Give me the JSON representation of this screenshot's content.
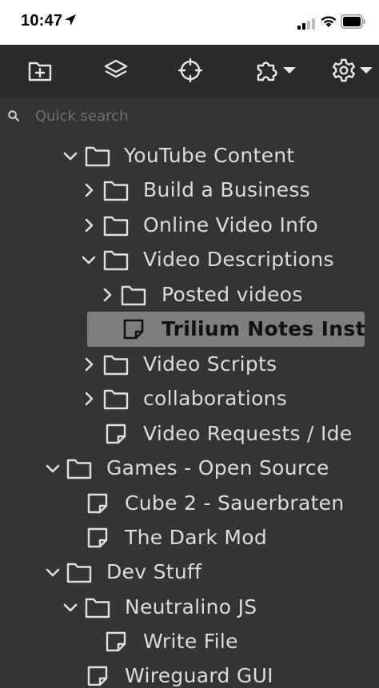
{
  "status_bar": {
    "time": "10:47"
  },
  "toolbar": {
    "buttons": [
      {
        "name": "new-note-icon"
      },
      {
        "name": "collapse-tree-icon"
      },
      {
        "name": "scroll-to-active-icon"
      },
      {
        "name": "plugins-icon"
      },
      {
        "name": "settings-icon"
      }
    ]
  },
  "search": {
    "placeholder": "Quick search",
    "value": ""
  },
  "tree": {
    "items": [
      {
        "label": "YouTube Content",
        "type": "folder",
        "expanded": true
      },
      {
        "label": "Build a Business",
        "type": "folder",
        "expanded": false
      },
      {
        "label": "Online Video Info",
        "type": "folder",
        "expanded": false
      },
      {
        "label": "Video Descriptions",
        "type": "folder",
        "expanded": true
      },
      {
        "label": "Posted videos",
        "type": "folder",
        "expanded": false
      },
      {
        "label": "Trilium Notes Insta",
        "type": "note",
        "active": true
      },
      {
        "label": "Video Scripts",
        "type": "folder",
        "expanded": false
      },
      {
        "label": "collaborations",
        "type": "folder",
        "expanded": false
      },
      {
        "label": "Video Requests / Ide",
        "type": "note"
      },
      {
        "label": "Games - Open Source",
        "type": "folder",
        "expanded": true
      },
      {
        "label": "Cube 2 - Sauerbraten",
        "type": "note"
      },
      {
        "label": "The Dark Mod",
        "type": "note"
      },
      {
        "label": "Dev Stuff",
        "type": "folder",
        "expanded": true
      },
      {
        "label": "Neutralino JS",
        "type": "folder",
        "expanded": true
      },
      {
        "label": "Write File",
        "type": "note"
      },
      {
        "label": "Wireguard GUI",
        "type": "note"
      }
    ]
  },
  "colors": {
    "background": "#343434",
    "toolbar": "#2a2a2a",
    "active_row": "#7e7e7e",
    "text": "#dcdcdc"
  }
}
